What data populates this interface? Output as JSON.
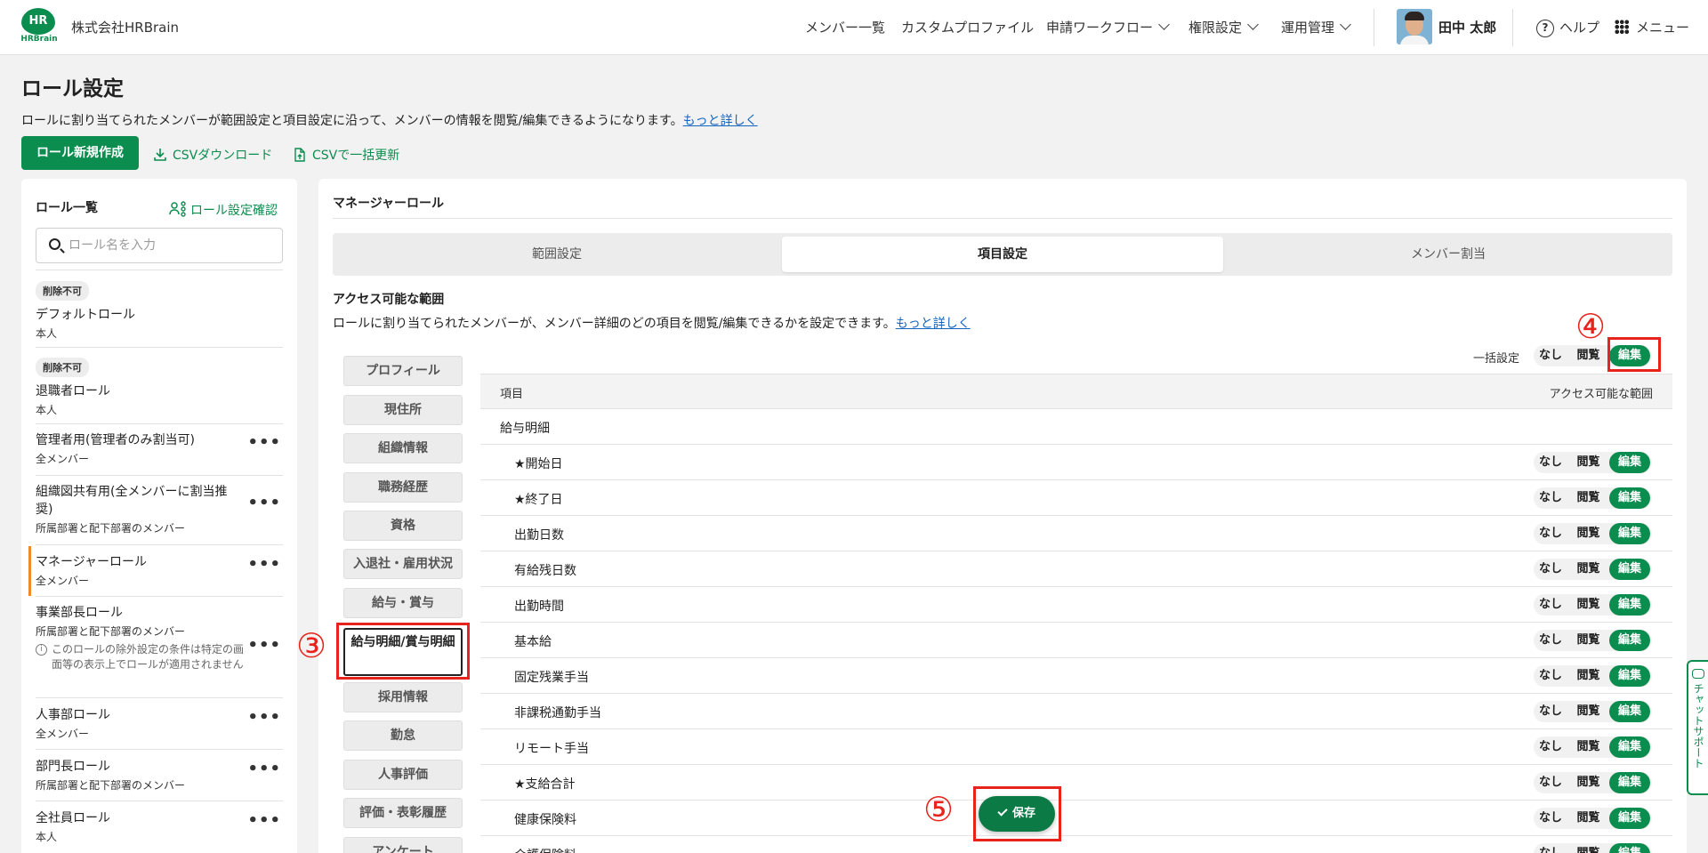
{
  "header": {
    "logo_text": "HR",
    "logo_sub": "HRBrain",
    "company": "株式会社HRBrain",
    "nav": [
      "メンバー一覧",
      "カスタムプロファイル",
      "申請ワークフロー",
      "権限設定",
      "運用管理"
    ],
    "user_name": "田中 太郎",
    "help": "ヘルプ",
    "menu": "メニュー"
  },
  "page": {
    "title": "ロール設定",
    "description": "ロールに割り当てられたメンバーが範囲設定と項目設定に沿って、メンバーの情報を閲覧/編集できるようになります。",
    "more_link": "もっと詳しく",
    "create_button": "ロール新規作成",
    "csv_download": "CSVダウンロード",
    "csv_update": "CSVで一括更新"
  },
  "roles_panel": {
    "title": "ロール一覧",
    "confirm_link": "ロール設定確認",
    "search_placeholder": "ロール名を入力",
    "roles": [
      {
        "badge": "削除不可",
        "name": "デフォルトロール",
        "scope": "本人"
      },
      {
        "badge": "削除不可",
        "name": "退職者ロール",
        "scope": "本人"
      },
      {
        "name": "管理者用(管理者のみ割当可)",
        "scope": "全メンバー"
      },
      {
        "name": "組織図共有用(全メンバーに割当推奨)",
        "scope": "所属部署と配下部署のメンバー"
      },
      {
        "name": "マネージャーロール",
        "scope": "全メンバー"
      },
      {
        "name": "事業部長ロール",
        "scope": "所属部署と配下部署のメンバー",
        "note": "このロールの除外設定の条件は特定の画面等の表示上でロールが適用されません"
      },
      {
        "name": "人事部ロール",
        "scope": "全メンバー"
      },
      {
        "name": "部門長ロール",
        "scope": "所属部署と配下部署のメンバー"
      },
      {
        "name": "全社員ロール",
        "scope": "本人"
      }
    ]
  },
  "detail": {
    "role_title": "マネージャーロール",
    "tabs": [
      "範囲設定",
      "項目設定",
      "メンバー割当"
    ],
    "active_tab": "項目設定",
    "section_title": "アクセス可能な範囲",
    "section_desc": "ロールに割り当てられたメンバーが、メンバー詳細のどの項目を閲覧/編集できるかを設定できます。",
    "more_link": "もっと詳しく",
    "categories": [
      "プロフィール",
      "現住所",
      "組織情報",
      "職務経歴",
      "資格",
      "入退社・雇用状況",
      "給与・賞与",
      "給与明細/賞与明細",
      "採用情報",
      "勤怠",
      "人事評価",
      "評価・表彰履歴",
      "アンケート"
    ],
    "selected_category": "給与明細/賞与明細",
    "bulk_label": "一括設定",
    "options": [
      "なし",
      "閲覧",
      "編集"
    ],
    "table_headers": [
      "項目",
      "アクセス可能な範囲"
    ],
    "group": "給与明細",
    "items": [
      "★開始日",
      "★終了日",
      "出勤日数",
      "有給残日数",
      "出勤時間",
      "基本給",
      "固定残業手当",
      "非課税通勤手当",
      "リモート手当",
      "★支給合計",
      "健康保険料",
      "介護保険料"
    ],
    "selected_option": "編集",
    "save_button": "保存"
  },
  "annotations": [
    "③",
    "④",
    "⑤"
  ],
  "chat_support": "チャットサポート",
  "colors": {
    "brand": "#0b8d4f",
    "annotation": "#e8231c",
    "active_role": "#f08a24"
  }
}
